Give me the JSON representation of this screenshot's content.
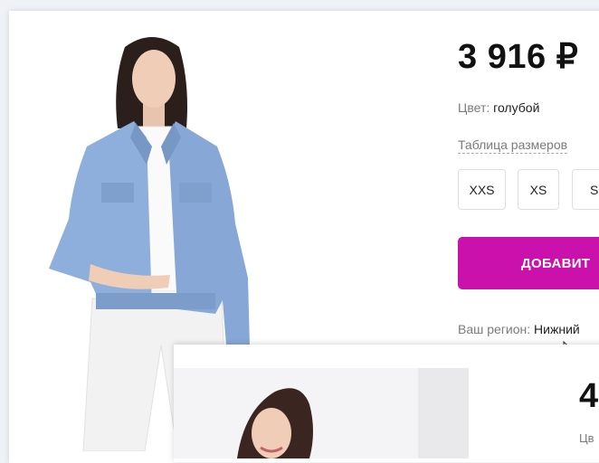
{
  "product": {
    "price": "3 916 ₽",
    "color_label": "Цвет:",
    "color_value": "голубой",
    "size_table_link": "Таблица размеров",
    "sizes": [
      "XXS",
      "XS",
      "S"
    ],
    "add_button_label": "ДОБАВИТ",
    "region_label": "Ваш регион:",
    "region_value": "Нижний"
  },
  "overlay": {
    "price": "4",
    "label": "Цв"
  },
  "colors": {
    "accent": "#cb11ab",
    "muted_text": "#7b7b7b",
    "denim": "#8eaedb"
  }
}
